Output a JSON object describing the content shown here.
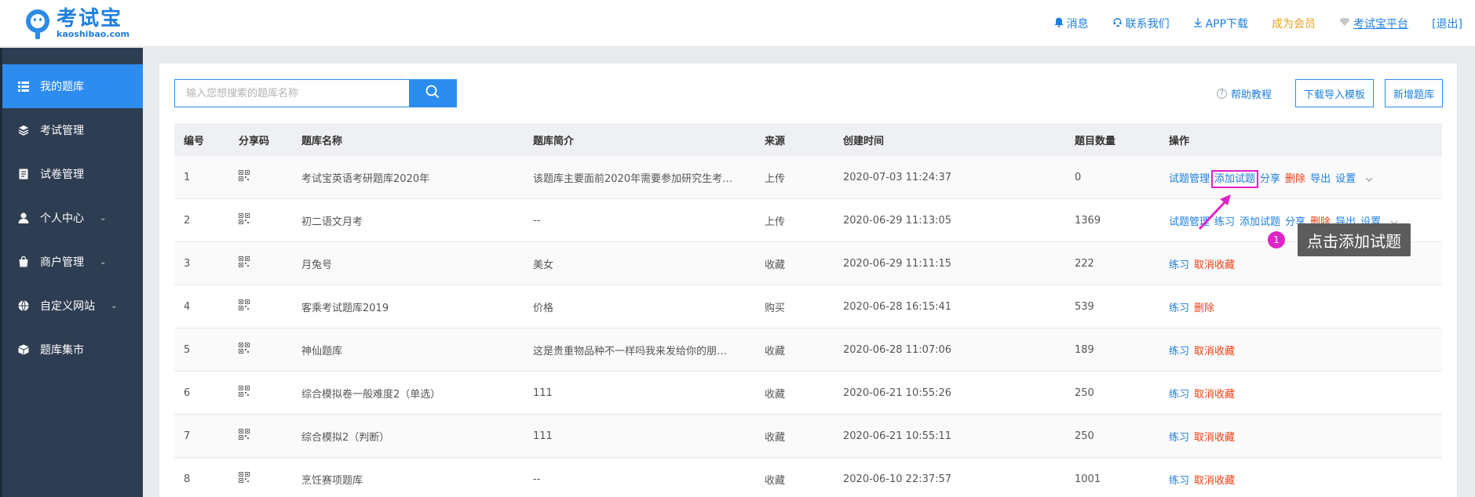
{
  "header": {
    "logo_cn": "考试宝",
    "logo_en": "kaoshibao.com",
    "nav": {
      "messages": "消息",
      "contact": "联系我们",
      "app": "APP下载",
      "vip": "成为会员",
      "platform": "考试宝平台",
      "logout": "[退出]"
    }
  },
  "sidebar": {
    "items": [
      {
        "label": "我的题库",
        "icon": "list-icon"
      },
      {
        "label": "考试管理",
        "icon": "layers-icon"
      },
      {
        "label": "试卷管理",
        "icon": "document-icon"
      },
      {
        "label": "个人中心",
        "icon": "user-icon"
      },
      {
        "label": "商户管理",
        "icon": "bag-icon"
      },
      {
        "label": "自定义网站",
        "icon": "globe-icon"
      },
      {
        "label": "题库集市",
        "icon": "box-icon"
      }
    ]
  },
  "toolbar": {
    "search_placeholder": "输入您想搜索的题库名称",
    "help": "帮助教程",
    "download_template": "下载导入模板",
    "new_bank": "新增题库"
  },
  "table": {
    "headers": [
      "编号",
      "分享码",
      "题库名称",
      "题库简介",
      "来源",
      "创建时间",
      "题目数量",
      "操作"
    ],
    "rows": [
      {
        "id": "1",
        "name": "考试宝英语考研题库2020年",
        "intro": "该题库主要面前2020年需要参加研究生考…",
        "source": "上传",
        "time": "2020-07-03 11:24:37",
        "count": "0",
        "ops": [
          {
            "t": "试题管理",
            "red": false
          },
          {
            "t": "添加试题",
            "red": false,
            "hl": true
          },
          {
            "t": "分享",
            "red": false
          },
          {
            "t": "删除",
            "red": true
          },
          {
            "t": "导出",
            "red": false
          },
          {
            "t": "设置",
            "red": false
          }
        ],
        "more": true
      },
      {
        "id": "2",
        "name": "初二语文月考",
        "intro": "--",
        "source": "上传",
        "time": "2020-06-29 11:13:05",
        "count": "1369",
        "ops": [
          {
            "t": "试题管理",
            "red": false
          },
          {
            "t": "练习",
            "red": false
          },
          {
            "t": "添加试题",
            "red": false
          },
          {
            "t": "分享",
            "red": false
          },
          {
            "t": "删除",
            "red": true
          },
          {
            "t": "导出",
            "red": false
          },
          {
            "t": "设置",
            "red": false
          }
        ],
        "more": true
      },
      {
        "id": "3",
        "name": "月兔号",
        "intro": "美女",
        "source": "收藏",
        "time": "2020-06-29 11:11:15",
        "count": "222",
        "ops": [
          {
            "t": "练习",
            "red": false
          },
          {
            "t": "取消收藏",
            "red": true
          }
        ],
        "more": false
      },
      {
        "id": "4",
        "name": "客乘考试题库2019",
        "intro": "价格",
        "source": "购买",
        "time": "2020-06-28 16:15:41",
        "count": "539",
        "ops": [
          {
            "t": "练习",
            "red": false
          },
          {
            "t": "删除",
            "red": true
          }
        ],
        "more": false
      },
      {
        "id": "5",
        "name": "神仙题库",
        "intro": "这是贵重物品种不一样吗我来发给你的朋…",
        "source": "收藏",
        "time": "2020-06-28 11:07:06",
        "count": "189",
        "ops": [
          {
            "t": "练习",
            "red": false
          },
          {
            "t": "取消收藏",
            "red": true
          }
        ],
        "more": false
      },
      {
        "id": "6",
        "name": "综合模拟卷一般难度2（单选）",
        "intro": "111",
        "source": "收藏",
        "time": "2020-06-21 10:55:26",
        "count": "250",
        "ops": [
          {
            "t": "练习",
            "red": false
          },
          {
            "t": "取消收藏",
            "red": true
          }
        ],
        "more": false
      },
      {
        "id": "7",
        "name": "综合模拟2（判断）",
        "intro": "111",
        "source": "收藏",
        "time": "2020-06-21 10:55:11",
        "count": "250",
        "ops": [
          {
            "t": "练习",
            "red": false
          },
          {
            "t": "取消收藏",
            "red": true
          }
        ],
        "more": false
      },
      {
        "id": "8",
        "name": "烹饪赛项题库",
        "intro": "--",
        "source": "收藏",
        "time": "2020-06-10 22:37:57",
        "count": "1001",
        "ops": [
          {
            "t": "练习",
            "red": false
          },
          {
            "t": "取消收藏",
            "red": true
          }
        ],
        "more": false
      }
    ]
  },
  "annotation": {
    "step": "1",
    "text": "点击添加试题",
    "color": "#e023c7"
  },
  "colors": {
    "accent": "#2d8cf0",
    "sidebar_bg": "#2e3e52",
    "danger": "#ed4014",
    "vip": "#e5a11f"
  }
}
